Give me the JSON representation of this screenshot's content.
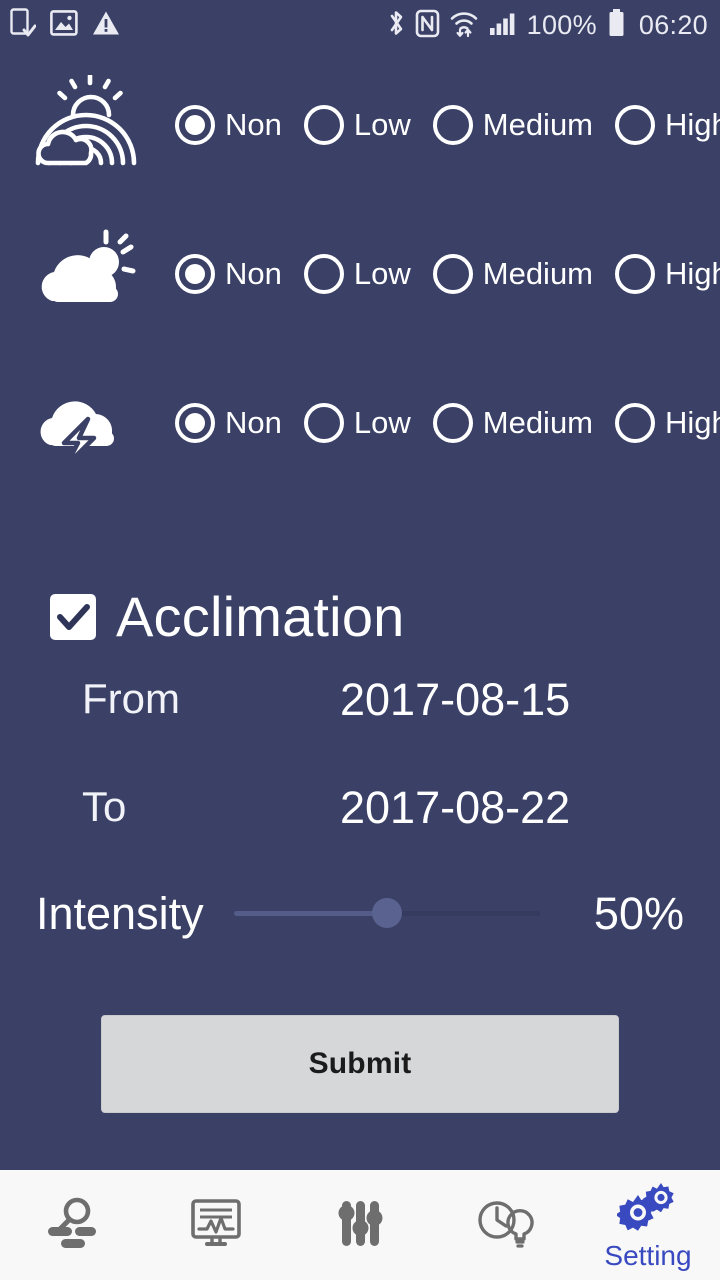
{
  "status_bar": {
    "left_icons": [
      "phone-download-icon",
      "image-icon",
      "warning-icon"
    ],
    "right_icons": [
      "bluetooth-icon",
      "nfc-icon",
      "wifi-icon",
      "cellular-signal-icon"
    ],
    "battery_percent": "100%",
    "clock": "06:20"
  },
  "weather_rows": [
    {
      "icon": "rainbow-sun-cloud-icon",
      "options": [
        {
          "label": "Non",
          "selected": true
        },
        {
          "label": "Low",
          "selected": false
        },
        {
          "label": "Medium",
          "selected": false
        },
        {
          "label": "High",
          "selected": false
        }
      ]
    },
    {
      "icon": "partly-cloudy-icon",
      "options": [
        {
          "label": "Non",
          "selected": true
        },
        {
          "label": "Low",
          "selected": false
        },
        {
          "label": "Medium",
          "selected": false
        },
        {
          "label": "High",
          "selected": false
        }
      ]
    },
    {
      "icon": "thunderstorm-icon",
      "options": [
        {
          "label": "Non",
          "selected": true
        },
        {
          "label": "Low",
          "selected": false
        },
        {
          "label": "Medium",
          "selected": false
        },
        {
          "label": "High",
          "selected": false
        }
      ]
    }
  ],
  "acclimation": {
    "label": "Acclimation",
    "checked": true,
    "from_label": "From",
    "from_value": "2017-08-15",
    "to_label": "To",
    "to_value": "2017-08-22"
  },
  "intensity": {
    "label": "Intensity",
    "value_text": "50%",
    "percent": 50
  },
  "submit": {
    "label": "Submit"
  },
  "bottom_nav": {
    "items": [
      {
        "icon": "inspect-search-icon",
        "label": "",
        "active": false
      },
      {
        "icon": "monitor-chart-icon",
        "label": "",
        "active": false
      },
      {
        "icon": "equalizer-sliders-icon",
        "label": "",
        "active": false
      },
      {
        "icon": "clock-bulb-icon",
        "label": "",
        "active": false
      },
      {
        "icon": "gears-icon",
        "label": "Setting",
        "active": true
      }
    ]
  },
  "colors": {
    "background": "#3a4066",
    "accent": "#3949c0",
    "nav_background": "#f8f8f9",
    "nav_icon": "#6e6e6e",
    "submit_background": "#d6d7d9",
    "text": "#ffffff"
  }
}
